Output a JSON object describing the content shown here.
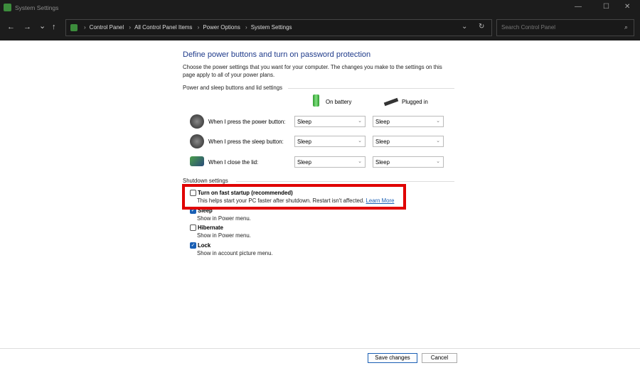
{
  "window": {
    "title": "System Settings",
    "minimize": "—",
    "maximize": "☐",
    "close": "✕"
  },
  "nav": {
    "back": "←",
    "forward": "→",
    "recent": "⌄",
    "up": "↑",
    "dropdown": "⌄",
    "refresh": "↻"
  },
  "breadcrumb": [
    "Control Panel",
    "All Control Panel Items",
    "Power Options",
    "System Settings"
  ],
  "search": {
    "placeholder": "Search Control Panel",
    "icon": "⌕"
  },
  "page": {
    "title": "Define power buttons and turn on password protection",
    "description": "Choose the power settings that you want for your computer. The changes you make to the settings on this page apply to all of your power plans.",
    "group1": "Power and sleep buttons and lid settings",
    "col_battery": "On battery",
    "col_plugged": "Plugged in",
    "rows": [
      {
        "label": "When I press the power button:",
        "battery": "Sleep",
        "plugged": "Sleep"
      },
      {
        "label": "When I press the sleep button:",
        "battery": "Sleep",
        "plugged": "Sleep"
      },
      {
        "label": "When I close the lid:",
        "battery": "Sleep",
        "plugged": "Sleep"
      }
    ],
    "group2": "Shutdown settings",
    "options": [
      {
        "label": "Turn on fast startup (recommended)",
        "desc": "This helps start your PC faster after shutdown. Restart isn't affected.",
        "link": "Learn More",
        "checked": false
      },
      {
        "label": "Sleep",
        "desc": "Show in Power menu.",
        "checked": true
      },
      {
        "label": "Hibernate",
        "desc": "Show in Power menu.",
        "checked": false
      },
      {
        "label": "Lock",
        "desc": "Show in account picture menu.",
        "checked": true
      }
    ]
  },
  "footer": {
    "save": "Save changes",
    "cancel": "Cancel"
  },
  "colors": {
    "highlight": "#e00000",
    "title": "#1e3a8a",
    "accent": "#1a5fb4"
  }
}
